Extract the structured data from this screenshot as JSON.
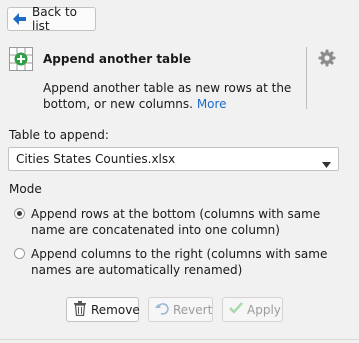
{
  "back_button": {
    "label": "Back to list"
  },
  "widget": {
    "title": "Append another table",
    "description": "Append another table as new rows at the bottom, or new columns.",
    "more_link": "More",
    "icon": "append-table-icon"
  },
  "table_select": {
    "label": "Table to append:",
    "selected": "Cities States Counties.xlsx"
  },
  "mode": {
    "label": "Mode",
    "options": [
      {
        "label": "Append rows at the bottom (columns with same name are concatenated into one column)",
        "checked": true
      },
      {
        "label": "Append columns to the right (columns with same names are automatically renamed)",
        "checked": false
      }
    ]
  },
  "actions": {
    "remove": "Remove",
    "revert": "Revert",
    "apply": "Apply"
  },
  "colors": {
    "accent": "#1f6cc6",
    "apply_check": "#4caf50"
  }
}
